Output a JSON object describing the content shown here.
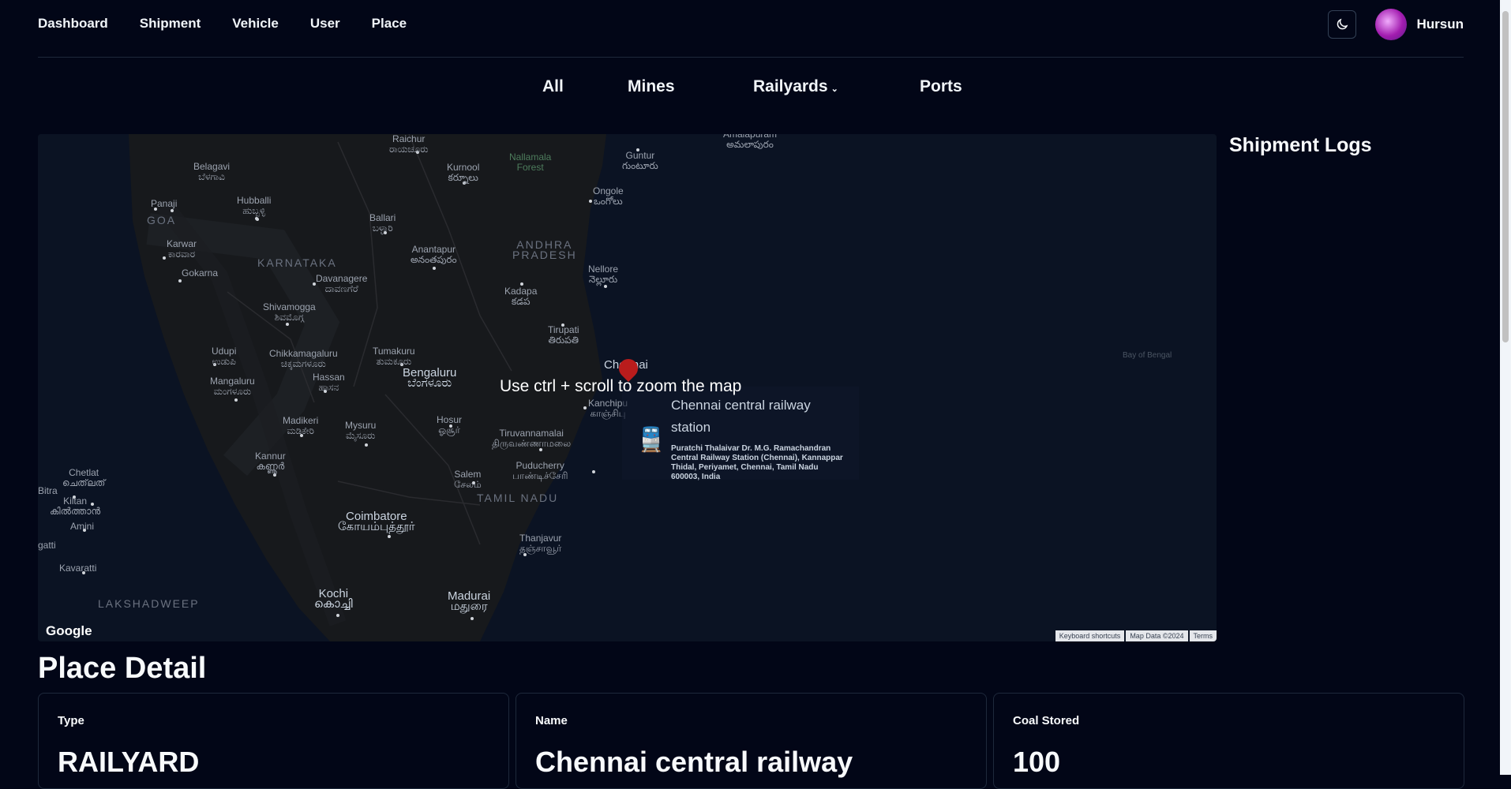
{
  "nav": {
    "links": [
      "Dashboard",
      "Shipment",
      "Vehicle",
      "User",
      "Place"
    ],
    "username": "Hursun"
  },
  "filters": {
    "all": "All",
    "mines": "Mines",
    "railyards": "Railyards",
    "ports": "Ports"
  },
  "map": {
    "zoom_hint": "Use ctrl + scroll to zoom the map",
    "labels": {
      "raichur": "Raichur\nರಾಯಚೂರು",
      "kurnool": "Kurnool\nకర్నూలు",
      "nallamala": "Nallamala\nForest",
      "guntur": "Guntur\nగుంటూరు",
      "amalapuram": "Amalapuram\nఅమలాపురం",
      "belagavi": "Belagavi\nಬೆಳಗಾವಿ",
      "hubballi": "Hubballi\nಹುಬ್ಬಳ್ಳಿ",
      "panaji": "Panaji",
      "goa": "GOA",
      "ballari": "Ballari\nಬಳ್ಳಾರಿ",
      "ongole": "Ongole\nఒంగోలు",
      "karwar": "Karwar\nಕಾರವಾರ",
      "andhra": "ANDHRA\nPRADESH",
      "karnataka": "KARNATAKA",
      "anantapur": "Anantapur\nఅనంతపురం",
      "nellore": "Nellore\nనెల్లూరు",
      "gokarna": "Gokarna",
      "davanagere": "Davanagere\nದಾವಣಗೆರೆ",
      "kadapa": "Kadapa\nకడప",
      "shivamogga": "Shivamogga\nಶಿವಮೊಗ್ಗ",
      "tirupati": "Tirupati\nతిరుపతి",
      "udupi": "Udupi\nಉಡುಪಿ",
      "chikkamagaluru": "Chikkamagaluru\nಚಿಕ್ಕಮಗಳೂರು",
      "tumakuru": "Tumakuru\nತುಮಕೂರು",
      "chennai": "Chennai",
      "bengaluru": "Bengaluru\nಬೆಂಗಳೂರು",
      "hassan": "Hassan\nಹಾಸನ",
      "mangaluru": "Mangaluru\nಮಂಗಳೂರು",
      "kanchipuram": "Kanchipu\nகாஞ்சிபு",
      "madikeri": "Madikeri\nಮಡಿಕೇರಿ",
      "mysuru": "Mysuru\nಮೈಸೂರು",
      "hosur": "Hosur\nஓசூர்",
      "tiruvannamalai": "Tiruvannamalai\nதிருவண்ணாமலை",
      "kannur": "Kannur\nകണ്ണൂർ",
      "puducherry": "Puducherry\nபாண்டிச்சேரி",
      "salem": "Salem\nசேலம்",
      "tamilnadu": "TAMIL NADU",
      "chetlat": "Chetlat\nചെത്‌ലത്",
      "bitra": "Bitra",
      "kiltan": "Kiltan\nകിൽത്താൻ",
      "amini": "Amini",
      "coimbatore": "Coimbatore\nகோயம்புத்தூர்",
      "thanjavur": "Thanjavur\nதஞ்சாவூர்",
      "agatti": "gatti",
      "kavaratti": "Kavaratti",
      "lakshadweep": "LAKSHADWEEP",
      "kochi": "Kochi\nകൊച്ചി",
      "madurai": "Madurai\nமதுரை",
      "bay": "Bay of Bengal"
    },
    "place_card": {
      "title": "Chennai central railway station",
      "address": "Puratchi Thalaivar Dr. M.G. Ramachandran Central Railway Station (Chennai), Kannappar Thidal, Periyamet, Chennai, Tamil Nadu 600003, India"
    },
    "google": "Google",
    "footer": [
      "Keyboard shortcuts",
      "Map Data ©2024",
      "Terms"
    ]
  },
  "logs": {
    "title": "Shipment Logs"
  },
  "detail": {
    "title": "Place Detail",
    "cards": [
      {
        "label": "Type",
        "value": "RAILYARD"
      },
      {
        "label": "Name",
        "value": "Chennai central railway"
      },
      {
        "label": "Coal Stored",
        "value": "100"
      }
    ]
  }
}
